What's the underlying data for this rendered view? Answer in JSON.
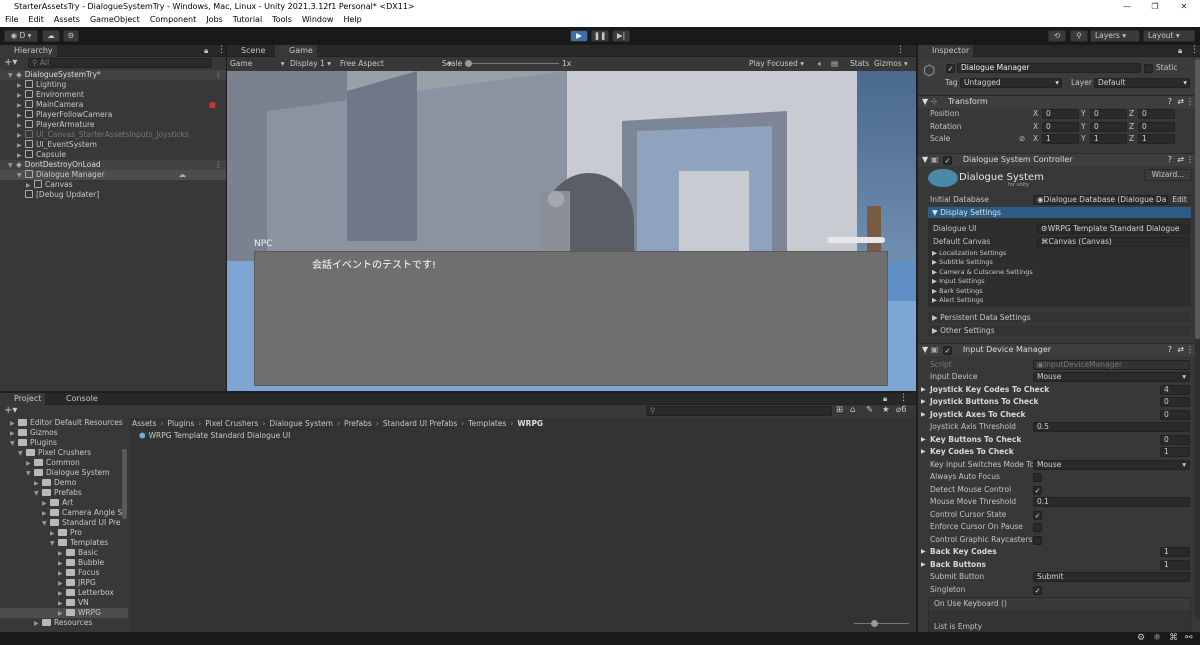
{
  "window": {
    "title": "StarterAssetsTry - DialogueSystemTry - Windows, Mac, Linux - Unity 2021.3.12f1 Personal* <DX11>"
  },
  "menu": [
    "File",
    "Edit",
    "Assets",
    "GameObject",
    "Component",
    "Jobs",
    "Tutorial",
    "Tools",
    "Window",
    "Help"
  ],
  "toolbar": {
    "account": "D",
    "layers": "Layers",
    "layout": "Layout"
  },
  "hierarchy": {
    "tab": "Hierarchy",
    "search_placeholder": "All",
    "items": [
      {
        "label": "DialogueSystemTry*",
        "depth": 0,
        "kind": "scene",
        "expanded": true
      },
      {
        "label": "Lighting",
        "depth": 1,
        "kind": "obj",
        "expanded": false
      },
      {
        "label": "Environment",
        "depth": 1,
        "kind": "obj",
        "expanded": false
      },
      {
        "label": "MainCamera",
        "depth": 1,
        "kind": "obj",
        "expanded": false
      },
      {
        "label": "PlayerFollowCamera",
        "depth": 1,
        "kind": "obj",
        "expanded": false
      },
      {
        "label": "PlayerArmature",
        "depth": 1,
        "kind": "obj",
        "expanded": false
      },
      {
        "label": "UI_Canvas_StarterAssetsInputs_Joysticks",
        "depth": 1,
        "kind": "obj",
        "expanded": false,
        "dim": true
      },
      {
        "label": "UI_EventSystem",
        "depth": 1,
        "kind": "obj",
        "expanded": false
      },
      {
        "label": "Capsule",
        "depth": 1,
        "kind": "obj",
        "expanded": false
      },
      {
        "label": "DontDestroyOnLoad",
        "depth": 0,
        "kind": "scene",
        "expanded": true
      },
      {
        "label": "Dialogue Manager",
        "depth": 1,
        "kind": "obj",
        "expanded": true,
        "selected": true
      },
      {
        "label": "Canvas",
        "depth": 2,
        "kind": "obj",
        "expanded": false
      },
      {
        "label": "[Debug Updater]",
        "depth": 1,
        "kind": "obj",
        "leaf": true
      }
    ]
  },
  "scene_tabs": [
    "Scene",
    "Game"
  ],
  "game_bar": {
    "mode": "Game",
    "display": "Display 1",
    "aspect": "Free Aspect",
    "scale_label": "Scale",
    "scale_value": "1x",
    "play_focused": "Play Focused",
    "stats": "Stats",
    "gizmos": "Gizmos"
  },
  "game_view": {
    "speaker": "NPC",
    "dialogue": "会話イベントのテストです!"
  },
  "project": {
    "tabs": [
      "Project",
      "Console"
    ],
    "tree": [
      {
        "label": "Editor Default Resources",
        "depth": 1
      },
      {
        "label": "Gizmos",
        "depth": 1
      },
      {
        "label": "Plugins",
        "depth": 1,
        "expanded": true
      },
      {
        "label": "Pixel Crushers",
        "depth": 2,
        "expanded": true
      },
      {
        "label": "Common",
        "depth": 3
      },
      {
        "label": "Dialogue System",
        "depth": 3,
        "expanded": true
      },
      {
        "label": "Demo",
        "depth": 4
      },
      {
        "label": "Prefabs",
        "depth": 4,
        "expanded": true
      },
      {
        "label": "Art",
        "depth": 5
      },
      {
        "label": "Camera Angle S",
        "depth": 5
      },
      {
        "label": "Standard UI Pre",
        "depth": 5,
        "expanded": true
      },
      {
        "label": "Pro",
        "depth": 6
      },
      {
        "label": "Templates",
        "depth": 6,
        "expanded": true
      },
      {
        "label": "Basic",
        "depth": 7
      },
      {
        "label": "Bubble",
        "depth": 7
      },
      {
        "label": "Focus",
        "depth": 7
      },
      {
        "label": "JRPG",
        "depth": 7
      },
      {
        "label": "Letterbox",
        "depth": 7
      },
      {
        "label": "VN",
        "depth": 7
      },
      {
        "label": "WRPG",
        "depth": 7,
        "selected": true
      },
      {
        "label": "Resources",
        "depth": 4
      }
    ],
    "breadcrumb": [
      "Assets",
      "Plugins",
      "Pixel Crushers",
      "Dialogue System",
      "Prefabs",
      "Standard UI Prefabs",
      "Templates",
      "WRPG"
    ],
    "files": [
      "WRPG Template Standard Dialogue UI"
    ],
    "hidden_count": "6"
  },
  "inspector": {
    "tab": "Inspector",
    "object_name": "Dialogue Manager",
    "static_label": "Static",
    "tag_label": "Tag",
    "tag_value": "Untagged",
    "layer_label": "Layer",
    "layer_value": "Default",
    "transform": {
      "title": "Transform",
      "rows": [
        {
          "label": "Position",
          "x": "0",
          "y": "0",
          "z": "0"
        },
        {
          "label": "Rotation",
          "x": "0",
          "y": "0",
          "z": "0"
        },
        {
          "label": "Scale",
          "x": "1",
          "y": "1",
          "z": "1"
        }
      ]
    },
    "dsc": {
      "title": "Dialogue System Controller",
      "logo_text": "Dialogue System",
      "logo_sub": "for unity",
      "wizard": "Wizard...",
      "initial_db_label": "Initial Database",
      "initial_db_value": "Dialogue Database (Dialogue Da",
      "edit": "Edit",
      "display_settings": "Display Settings",
      "dialogue_ui_label": "Dialogue UI",
      "dialogue_ui_value": "WRPG Template Standard Dialogue",
      "default_canvas_label": "Default Canvas",
      "default_canvas_value": "Canvas (Canvas)",
      "subsections": [
        "Localization Settings",
        "Subtitle Settings",
        "Camera & Cutscene Settings",
        "Input Settings",
        "Bark Settings",
        "Alert Settings"
      ],
      "persistent": "Persistent Data Settings",
      "other": "Other Settings"
    },
    "idm": {
      "title": "Input Device Manager",
      "script_label": "Script",
      "script_value": "InputDeviceManager",
      "rows": [
        {
          "label": "Input Device",
          "type": "dropdown",
          "value": "Mouse"
        },
        {
          "label": "Joystick Key Codes To Check",
          "type": "number",
          "value": "4",
          "bold": true
        },
        {
          "label": "Joystick Buttons To Check",
          "type": "number",
          "value": "0",
          "bold": true
        },
        {
          "label": "Joystick Axes To Check",
          "type": "number",
          "value": "0",
          "bold": true
        },
        {
          "label": "Joystick Axis Threshold",
          "type": "field",
          "value": "0.5"
        },
        {
          "label": "Key Buttons To Check",
          "type": "number",
          "value": "0",
          "bold": true
        },
        {
          "label": "Key Codes To Check",
          "type": "number",
          "value": "1",
          "bold": true
        },
        {
          "label": "Key Input Switches Mode To",
          "type": "dropdown",
          "value": "Mouse"
        },
        {
          "label": "Always Auto Focus",
          "type": "check",
          "value": ""
        },
        {
          "label": "Detect Mouse Control",
          "type": "check",
          "value": "✓"
        },
        {
          "label": "Mouse Move Threshold",
          "type": "field",
          "value": "0.1"
        },
        {
          "label": "Control Cursor State",
          "type": "check",
          "value": "✓"
        },
        {
          "label": "Enforce Cursor On Pause",
          "type": "check",
          "value": ""
        },
        {
          "label": "Control Graphic Raycasters",
          "type": "check",
          "value": ""
        },
        {
          "label": "Back Key Codes",
          "type": "number",
          "value": "1",
          "bold": true
        },
        {
          "label": "Back Buttons",
          "type": "number",
          "value": "1",
          "bold": true
        },
        {
          "label": "Submit Button",
          "type": "field",
          "value": "Submit"
        },
        {
          "label": "Singleton",
          "type": "check",
          "value": "✓"
        }
      ],
      "event_label": "On Use Keyboard ()",
      "list_empty": "List is Empty"
    }
  }
}
